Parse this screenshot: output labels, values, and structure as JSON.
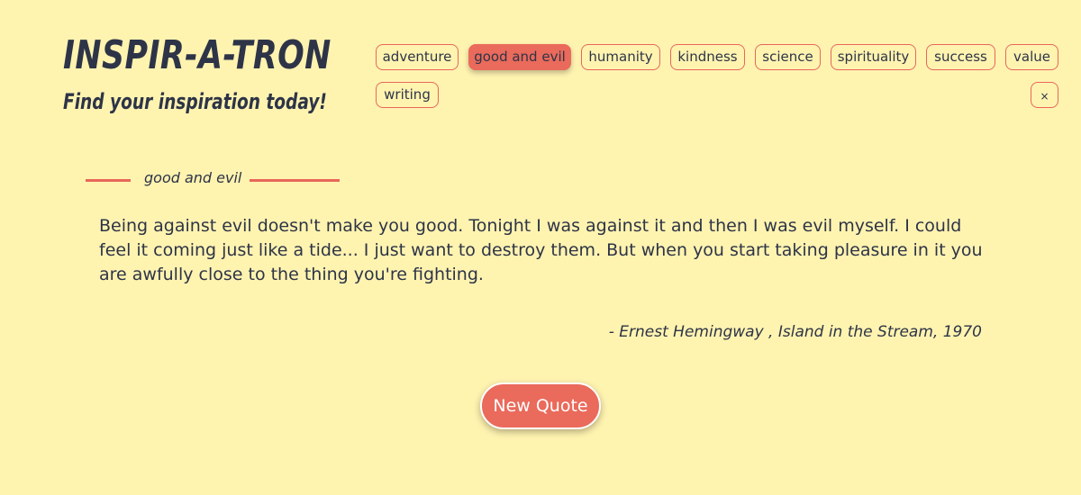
{
  "header": {
    "title": "INSPIR-A-TRON",
    "tagline": "Find your inspiration today!"
  },
  "tags": {
    "items": [
      {
        "label": "adventure"
      },
      {
        "label": "good and evil",
        "active": true
      },
      {
        "label": "humanity"
      },
      {
        "label": "kindness"
      },
      {
        "label": "science"
      },
      {
        "label": "spirituality"
      },
      {
        "label": "success"
      },
      {
        "label": "value"
      },
      {
        "label": "writing"
      }
    ],
    "clear_label": "×"
  },
  "quote": {
    "category": "good and evil",
    "text": "Being against evil doesn't make you good. Tonight I was against it and then I was evil myself. I could feel it coming just like a tide... I just want to destroy them. But when you start taking pleasure in it you are awfully close to the thing you're fighting.",
    "attribution": "- Ernest Hemingway , Island in the Stream, 1970"
  },
  "actions": {
    "new_quote_label": "New Quote"
  },
  "colors": {
    "background": "#fff3b0",
    "accent": "#ea6a5b",
    "text": "#2d3447"
  }
}
